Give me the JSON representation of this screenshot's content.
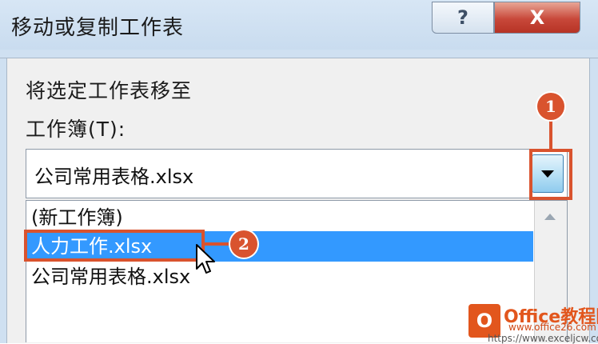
{
  "window": {
    "title": "移动或复制工作表",
    "help_label": "?",
    "close_label": "X"
  },
  "form": {
    "move_to_label": "将选定工作表移至",
    "workbook_label": "工作簿(T):",
    "workbook_value": "公司常用表格.xlsx"
  },
  "workbook_list": {
    "items": [
      "(新工作簿)",
      "人力工作.xlsx",
      "公司常用表格.xlsx"
    ],
    "selected_index": 1
  },
  "callouts": {
    "step1": "1",
    "step2": "2"
  },
  "watermark": {
    "logo_letter": "O",
    "title": "Office教程网",
    "url_1": "www.office26.com",
    "url_2": "https://www.exceljcw.com"
  },
  "colors": {
    "selection": "#3399ff",
    "callout": "#d9532e",
    "close_button": "#c8483a"
  }
}
